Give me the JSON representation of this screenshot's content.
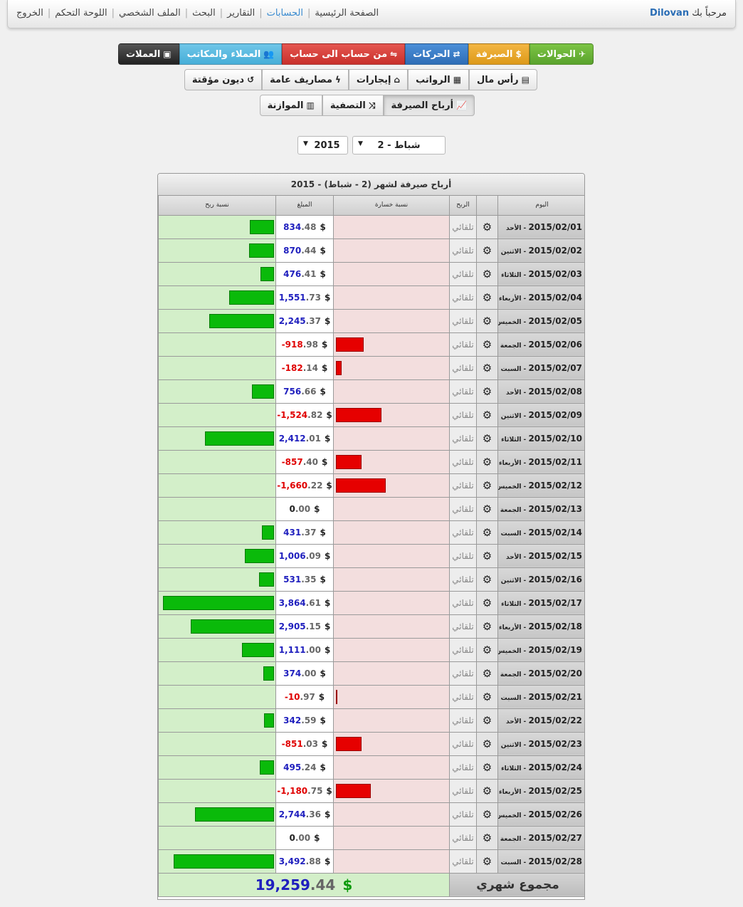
{
  "header": {
    "welcome_prefix": "مرحباً بك",
    "username": "Dilovan",
    "nav": [
      {
        "label": "الصفحة الرئيسية",
        "active": false
      },
      {
        "label": "الحسابات",
        "active": true
      },
      {
        "label": "التقارير",
        "active": false
      },
      {
        "label": "البحث",
        "active": false
      },
      {
        "label": "الملف الشخصي",
        "active": false
      },
      {
        "label": "اللوحة التحكم",
        "active": false
      },
      {
        "label": "الخروج",
        "active": false
      }
    ]
  },
  "toolbar1": [
    {
      "label": "الحوالات",
      "icon": "rocket-icon",
      "color": "#6ab63a"
    },
    {
      "label": "الصيرفة",
      "icon": "dollar-icon",
      "color": "#e8a82e"
    },
    {
      "label": "الحركات",
      "icon": "exchange-icon",
      "color": "#3a7ec7"
    },
    {
      "label": "من حساب الى حساب",
      "icon": "retweet-icon",
      "color": "#d9403b"
    },
    {
      "label": "العملاء والمكاتب",
      "icon": "users-icon",
      "color": "#5bbce2"
    },
    {
      "label": "العملات",
      "icon": "money-icon",
      "color": "#333333"
    }
  ],
  "toolbar2": [
    {
      "label": "رأس مال",
      "icon": "briefcase-icon"
    },
    {
      "label": "الرواتب",
      "icon": "calendar-icon"
    },
    {
      "label": "إيجارات",
      "icon": "home-icon"
    },
    {
      "label": "مصاريف عامة",
      "icon": "bolt-icon"
    },
    {
      "label": "ديون مؤقتة",
      "icon": "history-icon"
    }
  ],
  "toolbar3": [
    {
      "label": "أرباح الصيرفة",
      "icon": "line-chart-icon",
      "pressed": true
    },
    {
      "label": "التصفية",
      "icon": "random-icon",
      "pressed": false
    },
    {
      "label": "الموازنة",
      "icon": "bar-chart-icon",
      "pressed": false
    }
  ],
  "filters": {
    "month": "2 - شباط",
    "year": "2015"
  },
  "table": {
    "title": "أرباح صيرفة لشهر (2 - شباط) - 2015",
    "headers": {
      "day": "اليوم",
      "profit": "الربح",
      "loss_ratio": "نسبة خسارة",
      "amount": "المبلغ",
      "profit_ratio": "نسبة ربح"
    },
    "auto_label": "تلقائي",
    "currency": "$",
    "rows": [
      {
        "date": "2015/02/01",
        "dayname": "الأحد",
        "int": "834",
        "dec": ".48",
        "value": 834.48
      },
      {
        "date": "2015/02/02",
        "dayname": "الاثنين",
        "int": "870",
        "dec": ".44",
        "value": 870.44
      },
      {
        "date": "2015/02/03",
        "dayname": "الثلاثاء",
        "int": "476",
        "dec": ".41",
        "value": 476.41
      },
      {
        "date": "2015/02/04",
        "dayname": "الأربعاء",
        "int": "1,551",
        "dec": ".73",
        "value": 1551.73
      },
      {
        "date": "2015/02/05",
        "dayname": "الخميس",
        "int": "2,245",
        "dec": ".37",
        "value": 2245.37
      },
      {
        "date": "2015/02/06",
        "dayname": "الجمعة",
        "int": "-918",
        "dec": ".98",
        "value": -918.98
      },
      {
        "date": "2015/02/07",
        "dayname": "السبت",
        "int": "-182",
        "dec": ".14",
        "value": -182.14
      },
      {
        "date": "2015/02/08",
        "dayname": "الأحد",
        "int": "756",
        "dec": ".66",
        "value": 756.66
      },
      {
        "date": "2015/02/09",
        "dayname": "الاثنين",
        "int": "-1,524",
        "dec": ".82",
        "value": -1524.82
      },
      {
        "date": "2015/02/10",
        "dayname": "الثلاثاء",
        "int": "2,412",
        "dec": ".01",
        "value": 2412.01
      },
      {
        "date": "2015/02/11",
        "dayname": "الأربعاء",
        "int": "-857",
        "dec": ".40",
        "value": -857.4
      },
      {
        "date": "2015/02/12",
        "dayname": "الخميس",
        "int": "-1,660",
        "dec": ".22",
        "value": -1660.22
      },
      {
        "date": "2015/02/13",
        "dayname": "الجمعة",
        "int": "0",
        "dec": ".00",
        "value": 0
      },
      {
        "date": "2015/02/14",
        "dayname": "السبت",
        "int": "431",
        "dec": ".37",
        "value": 431.37
      },
      {
        "date": "2015/02/15",
        "dayname": "الأحد",
        "int": "1,006",
        "dec": ".09",
        "value": 1006.09
      },
      {
        "date": "2015/02/16",
        "dayname": "الاثنين",
        "int": "531",
        "dec": ".35",
        "value": 531.35
      },
      {
        "date": "2015/02/17",
        "dayname": "الثلاثاء",
        "int": "3,864",
        "dec": ".61",
        "value": 3864.61
      },
      {
        "date": "2015/02/18",
        "dayname": "الأربعاء",
        "int": "2,905",
        "dec": ".15",
        "value": 2905.15
      },
      {
        "date": "2015/02/19",
        "dayname": "الخميس",
        "int": "1,111",
        "dec": ".00",
        "value": 1111.0
      },
      {
        "date": "2015/02/20",
        "dayname": "الجمعة",
        "int": "374",
        "dec": ".00",
        "value": 374.0
      },
      {
        "date": "2015/02/21",
        "dayname": "السبت",
        "int": "-10",
        "dec": ".97",
        "value": -10.97
      },
      {
        "date": "2015/02/22",
        "dayname": "الأحد",
        "int": "342",
        "dec": ".59",
        "value": 342.59
      },
      {
        "date": "2015/02/23",
        "dayname": "الاثنين",
        "int": "-851",
        "dec": ".03",
        "value": -851.03
      },
      {
        "date": "2015/02/24",
        "dayname": "الثلاثاء",
        "int": "495",
        "dec": ".24",
        "value": 495.24
      },
      {
        "date": "2015/02/25",
        "dayname": "الأربعاء",
        "int": "-1,180",
        "dec": ".75",
        "value": -1180.75
      },
      {
        "date": "2015/02/26",
        "dayname": "الخميس",
        "int": "2,744",
        "dec": ".36",
        "value": 2744.36
      },
      {
        "date": "2015/02/27",
        "dayname": "الجمعة",
        "int": "0",
        "dec": ".00",
        "value": 0
      },
      {
        "date": "2015/02/28",
        "dayname": "السبت",
        "int": "3,492",
        "dec": ".88",
        "value": 3492.88
      }
    ],
    "total": {
      "label": "مجموع شهري",
      "int": "19,259",
      "dec": ".44"
    }
  }
}
